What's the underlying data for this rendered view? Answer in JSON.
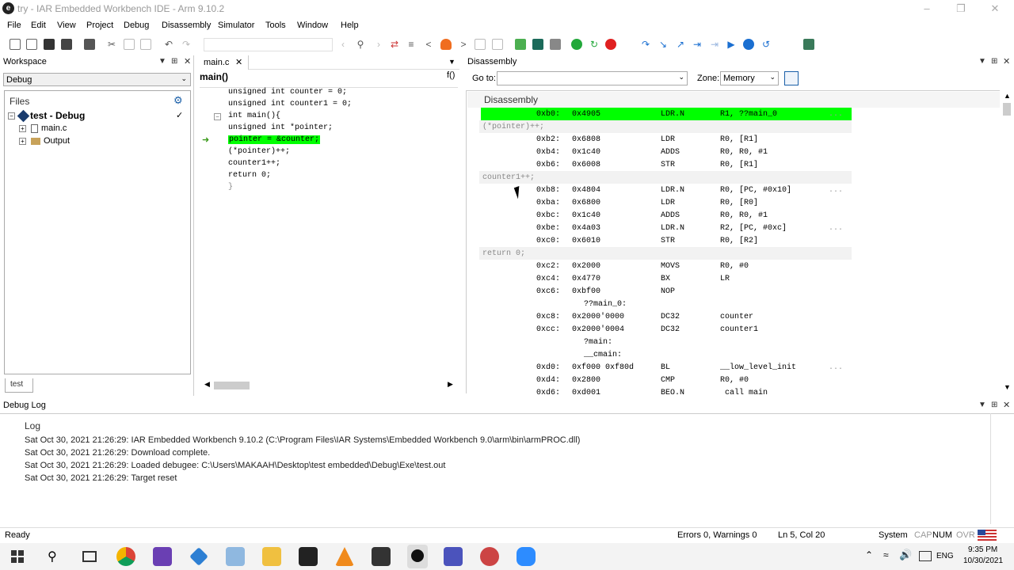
{
  "window": {
    "title": "try - IAR Embedded Workbench IDE - Arm 9.10.2"
  },
  "menu": [
    "File",
    "Edit",
    "View",
    "Project",
    "Debug",
    "Disassembly",
    "Simulator",
    "Tools",
    "Window",
    "Help"
  ],
  "workspace": {
    "title": "Workspace",
    "config": "Debug",
    "files_label": "Files",
    "project": "test - Debug",
    "items": [
      "main.c",
      "Output"
    ],
    "tab": "test"
  },
  "editor": {
    "tab": "main.c",
    "function": "main()",
    "lines": [
      "unsigned int counter = 0;",
      "unsigned int counter1 = 0;",
      "int main(){",
      "unsigned int *pointer;",
      "pointer = &counter;",
      "(*pointer)++;",
      "counter1++;",
      "return 0;",
      "}"
    ]
  },
  "disassembly": {
    "title": "Disassembly",
    "goto_label": "Go to:",
    "zone_label": "Zone:",
    "zone_value": "Memory",
    "header": "Disassembly",
    "rows": [
      {
        "kind": "asm",
        "addr": "0xb0:",
        "code": "0x4905",
        "op": "LDR.N",
        "args": "R1, ??main_0",
        "cmt": "...",
        "current": true
      },
      {
        "kind": "src",
        "text": "(*pointer)++;"
      },
      {
        "kind": "asm",
        "addr": "0xb2:",
        "code": "0x6808",
        "op": "LDR",
        "args": "R0, [R1]",
        "cmt": ""
      },
      {
        "kind": "asm",
        "addr": "0xb4:",
        "code": "0x1c40",
        "op": "ADDS",
        "args": "R0, R0, #1",
        "cmt": ""
      },
      {
        "kind": "asm",
        "addr": "0xb6:",
        "code": "0x6008",
        "op": "STR",
        "args": "R0, [R1]",
        "cmt": ""
      },
      {
        "kind": "src",
        "text": "counter1++;"
      },
      {
        "kind": "asm",
        "addr": "0xb8:",
        "code": "0x4804",
        "op": "LDR.N",
        "args": "R0, [PC, #0x10]",
        "cmt": "..."
      },
      {
        "kind": "asm",
        "addr": "0xba:",
        "code": "0x6800",
        "op": "LDR",
        "args": "R0, [R0]",
        "cmt": ""
      },
      {
        "kind": "asm",
        "addr": "0xbc:",
        "code": "0x1c40",
        "op": "ADDS",
        "args": "R0, R0, #1",
        "cmt": ""
      },
      {
        "kind": "asm",
        "addr": "0xbe:",
        "code": "0x4a03",
        "op": "LDR.N",
        "args": "R2, [PC, #0xc]",
        "cmt": "..."
      },
      {
        "kind": "asm",
        "addr": "0xc0:",
        "code": "0x6010",
        "op": "STR",
        "args": "R0, [R2]",
        "cmt": ""
      },
      {
        "kind": "src",
        "text": "return 0;"
      },
      {
        "kind": "asm",
        "addr": "0xc2:",
        "code": "0x2000",
        "op": "MOVS",
        "args": "R0, #0",
        "cmt": ""
      },
      {
        "kind": "asm",
        "addr": "0xc4:",
        "code": "0x4770",
        "op": "BX",
        "args": "LR",
        "cmt": ""
      },
      {
        "kind": "asm",
        "addr": "0xc6:",
        "code": "0xbf00",
        "op": "NOP",
        "args": "",
        "cmt": ""
      },
      {
        "kind": "label",
        "text": "??main_0:"
      },
      {
        "kind": "asm",
        "addr": "0xc8:",
        "code": "0x2000'0000",
        "op": "DC32",
        "args": "counter",
        "cmt": ""
      },
      {
        "kind": "asm",
        "addr": "0xcc:",
        "code": "0x2000'0004",
        "op": "DC32",
        "args": "counter1",
        "cmt": ""
      },
      {
        "kind": "label",
        "text": "?main:"
      },
      {
        "kind": "label",
        "text": "__cmain:"
      },
      {
        "kind": "asm",
        "addr": "0xd0:",
        "code": "0xf000 0xf80d",
        "op": "BL",
        "args": "__low_level_init",
        "cmt": "..."
      },
      {
        "kind": "asm",
        "addr": "0xd4:",
        "code": "0x2800",
        "op": "CMP",
        "args": "R0, #0",
        "cmt": ""
      },
      {
        "kind": "asm",
        "addr": "0xd6:",
        "code": "0xd001",
        "op": "BEQ.N",
        "args": "_call_main",
        "cmt": ""
      }
    ]
  },
  "log": {
    "title": "Debug Log",
    "header": "Log",
    "lines": [
      "Sat Oct 30, 2021 21:26:29: IAR Embedded Workbench 9.10.2 (C:\\Program Files\\IAR Systems\\Embedded Workbench 9.0\\arm\\bin\\armPROC.dll)",
      "Sat Oct 30, 2021 21:26:29: Download complete.",
      "Sat Oct 30, 2021 21:26:29: Loaded debugee: C:\\Users\\MAKAAH\\Desktop\\test embedded\\Debug\\Exe\\test.out",
      "Sat Oct 30, 2021 21:26:29: Target reset"
    ]
  },
  "status": {
    "ready": "Ready",
    "errors": "Errors 0, Warnings 0",
    "position": "Ln 5, Col 20",
    "system": "System",
    "cap": "CAP",
    "num": "NUM",
    "ovr": "OVR"
  },
  "taskbar": {
    "lang": "ENG",
    "time": "9:35 PM",
    "date": "10/30/2021"
  },
  "colors": {
    "current_line": "#00ff00",
    "accent": "#0078d7"
  }
}
